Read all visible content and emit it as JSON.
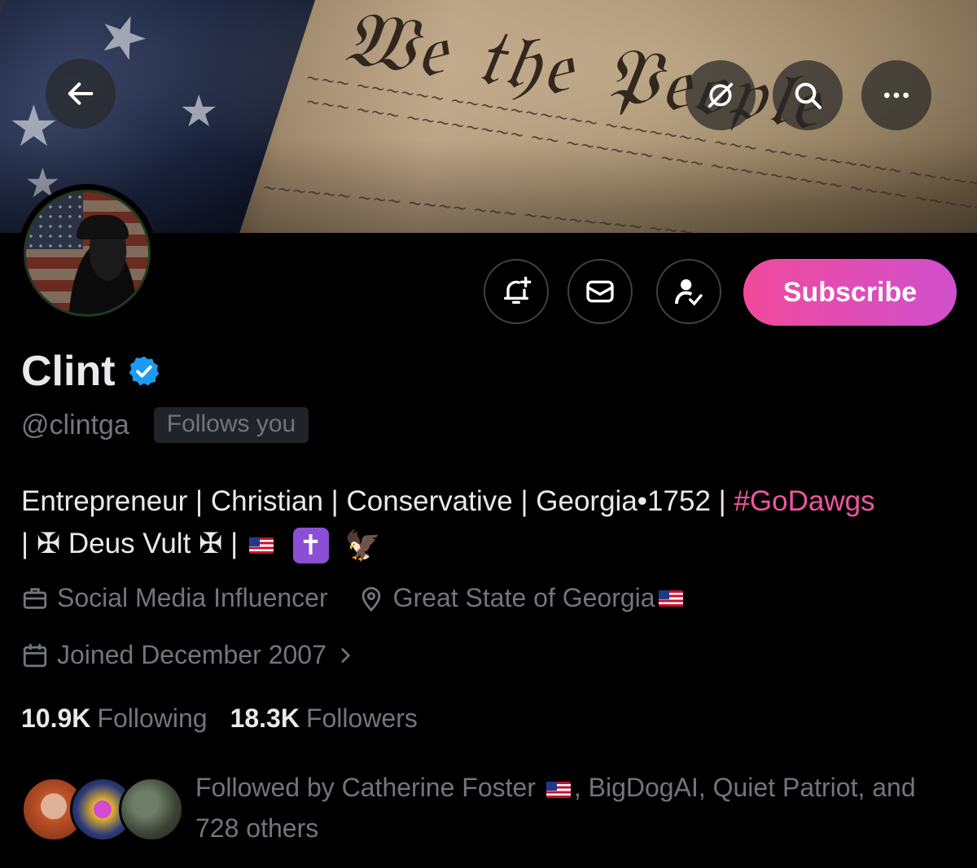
{
  "banner": {
    "icons": [
      "back-arrow-icon",
      "grok-icon",
      "search-icon",
      "more-icon"
    ]
  },
  "actions": {
    "notify_icon": "bell-plus-icon",
    "message_icon": "envelope-icon",
    "follow_icon": "person-check-icon",
    "subscribe_label": "Subscribe",
    "subscribe_gradient": [
      "#f04a9a",
      "#d04fcd"
    ]
  },
  "profile": {
    "name": "Clint",
    "verified": true,
    "handle": "@clintga",
    "follows_you": "Follows you",
    "bio": {
      "text": "Entrepreneur | Christian | Conservative | Georgia•1752 | ",
      "hashtag": "#GoDawgs",
      "line2_prefix": "| ✠ Deus Vult ✠ | ",
      "cross": "✝",
      "eagle": "🦅"
    },
    "category": "Social Media Influencer",
    "location": "Great State of Georgia",
    "joined": "Joined December 2007"
  },
  "stats": {
    "following_count": "10.9K",
    "following_label": "Following",
    "followers_count": "18.3K",
    "followers_label": "Followers"
  },
  "followed_by": {
    "prefix": "Followed by Catherine Foster",
    "rest": ", BigDogAI, Quiet Patriot, and 728 others"
  },
  "colors": {
    "background": "#000000",
    "text": "#e7e9ea",
    "muted": "#71767b",
    "hashtag": "#f0559f",
    "verified": "#1d9bf0"
  }
}
